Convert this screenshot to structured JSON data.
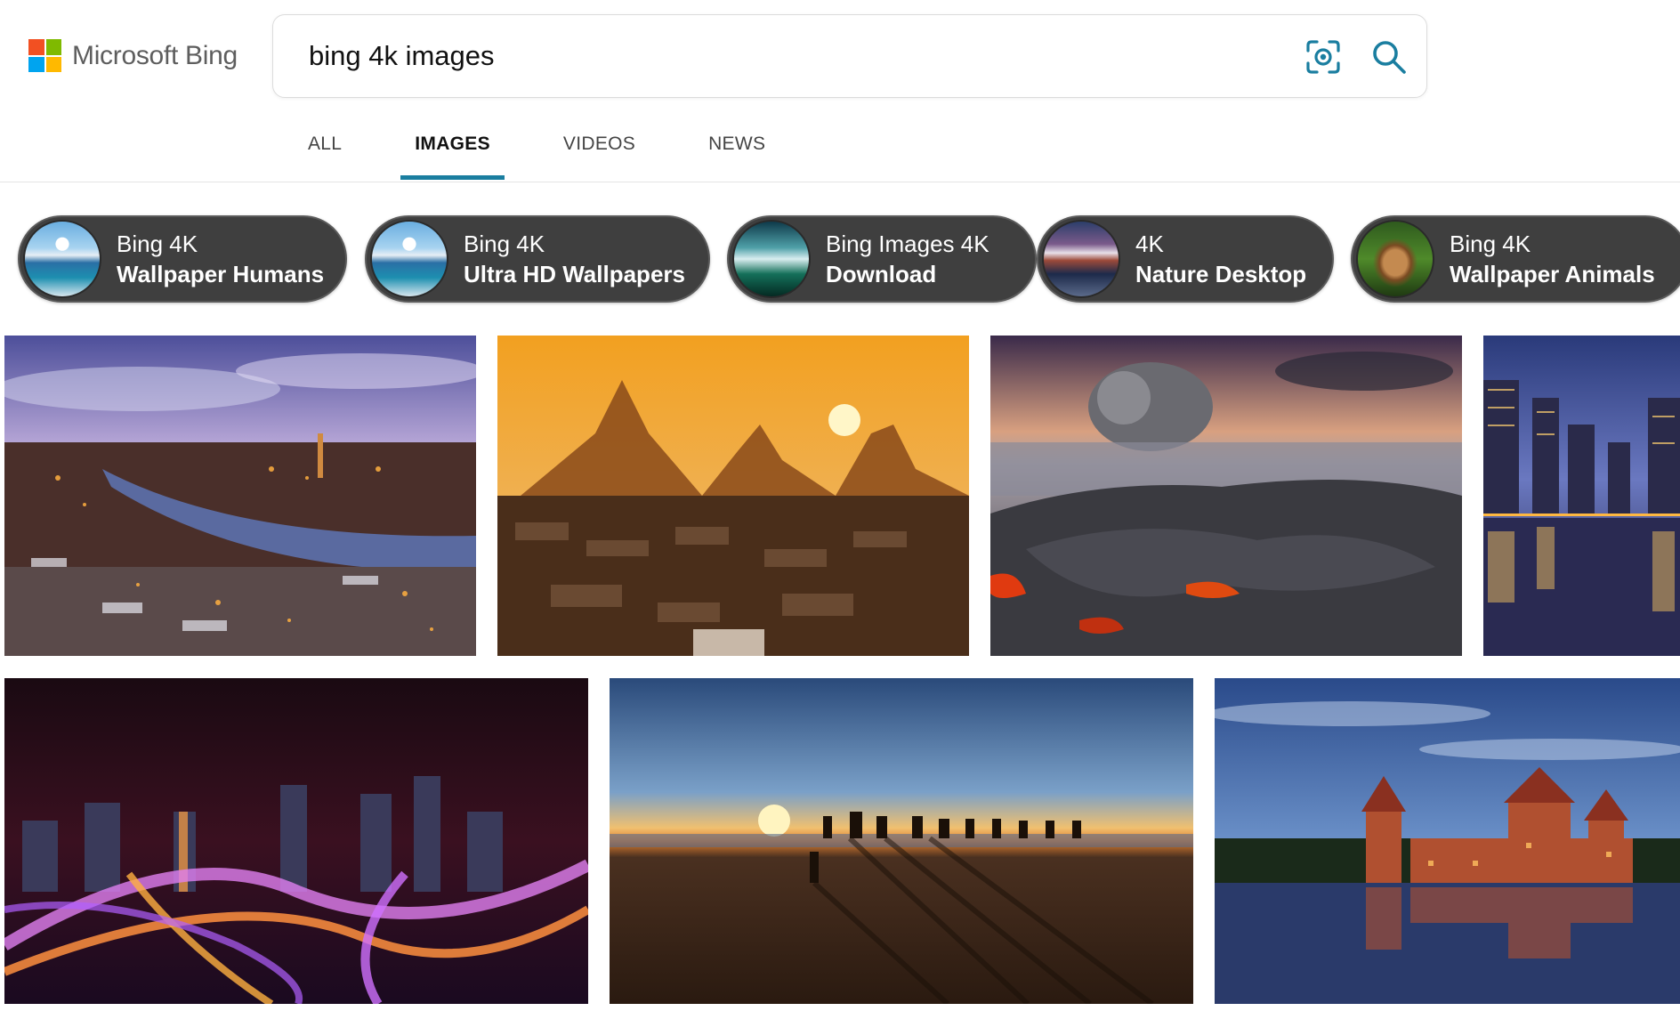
{
  "brand": {
    "name": "Microsoft Bing"
  },
  "search": {
    "query": "bing 4k images"
  },
  "tabs": [
    {
      "label": "ALL",
      "active": false
    },
    {
      "label": "IMAGES",
      "active": true
    },
    {
      "label": "VIDEOS",
      "active": false
    },
    {
      "label": "NEWS",
      "active": false
    }
  ],
  "related": [
    {
      "line1": "Bing 4K",
      "line2": "Wallpaper Humans"
    },
    {
      "line1": "Bing 4K",
      "line2": "Ultra HD Wallpapers"
    },
    {
      "line1": "Bing Images 4K",
      "line2": "Download"
    },
    {
      "line1": "4K",
      "line2": "Nature Desktop"
    },
    {
      "line1": "Bing 4K",
      "line2": "Wallpaper Animals"
    }
  ],
  "icons": {
    "visual_search": "visual-search-icon",
    "search": "search-icon"
  },
  "colors": {
    "accent": "#1a7ea0",
    "chip_bg": "#3f3f3f"
  }
}
